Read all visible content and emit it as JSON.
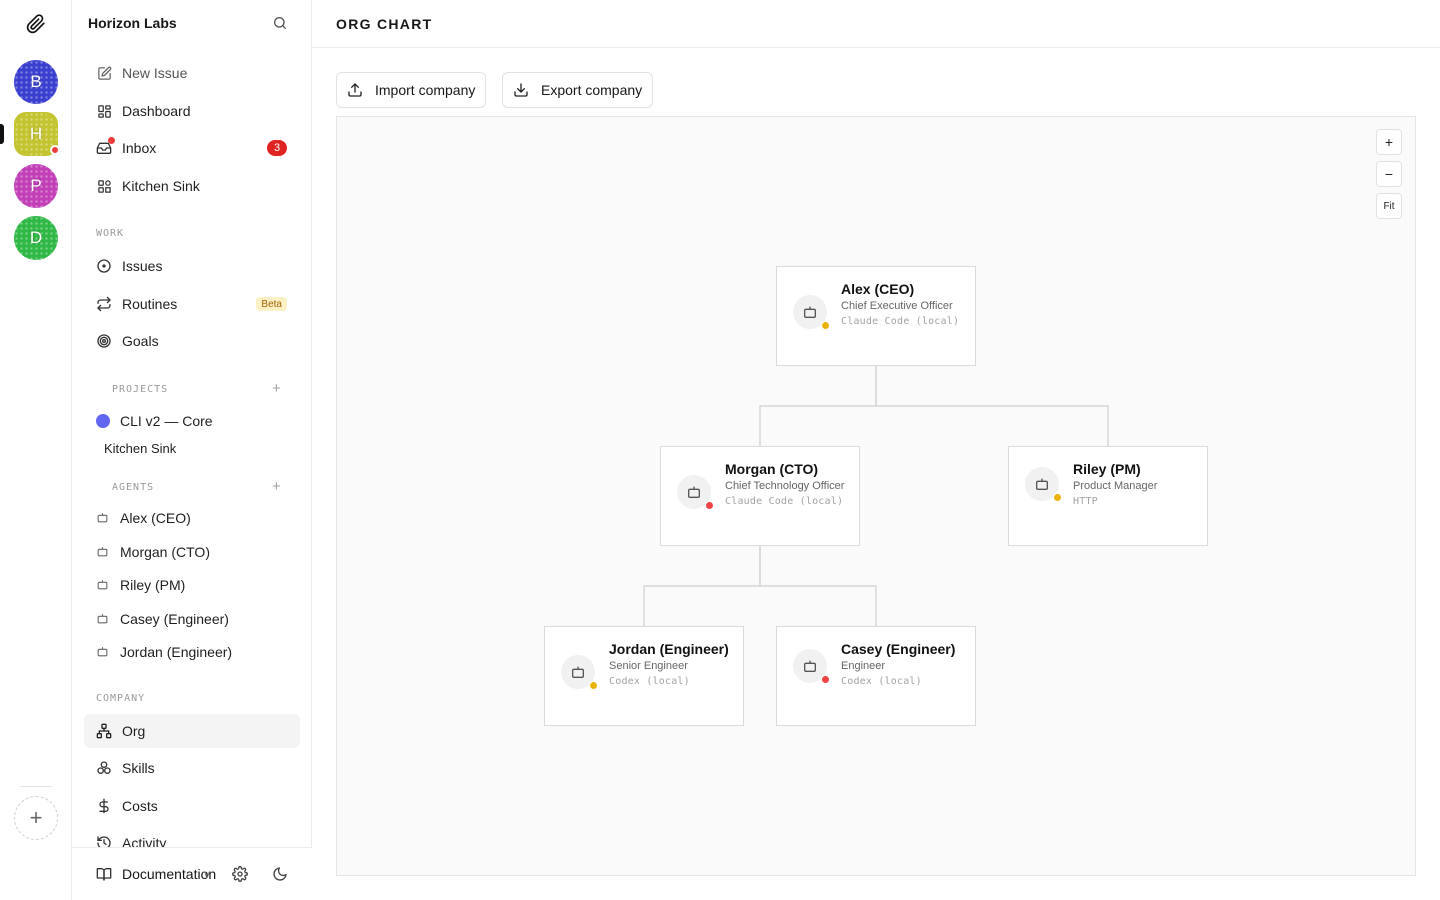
{
  "rail": {
    "companies": [
      {
        "initial": "B",
        "color": "#3b3fcf"
      },
      {
        "initial": "H",
        "color": "#c4c431",
        "active": true,
        "notification": true
      },
      {
        "initial": "P",
        "color": "#c23fb7"
      },
      {
        "initial": "D",
        "color": "#2fb845"
      }
    ],
    "add_label": "+"
  },
  "sidebar": {
    "company_name": "Horizon Labs",
    "top_items": [
      {
        "label": "New Issue",
        "icon": "edit-icon"
      },
      {
        "label": "Dashboard",
        "icon": "dashboard-icon"
      },
      {
        "label": "Inbox",
        "icon": "inbox-icon",
        "badge": "3"
      },
      {
        "label": "Kitchen Sink",
        "icon": "shapes-icon"
      }
    ],
    "work_label": "WORK",
    "work_items": [
      {
        "label": "Issues",
        "icon": "circle-dot-icon"
      },
      {
        "label": "Routines",
        "icon": "repeat-icon",
        "badge": "Beta"
      },
      {
        "label": "Goals",
        "icon": "target-icon"
      }
    ],
    "projects_label": "PROJECTS",
    "projects_add": "+",
    "projects": [
      {
        "label": "CLI v2 — Core",
        "color": "#6366f1",
        "children": [
          "Kitchen Sink"
        ]
      }
    ],
    "agents_label": "AGENTS",
    "agents_add": "+",
    "agents": [
      "Alex (CEO)",
      "Morgan (CTO)",
      "Riley (PM)",
      "Casey (Engineer)",
      "Jordan (Engineer)"
    ],
    "company_label": "COMPANY",
    "company_items": [
      {
        "label": "Org",
        "icon": "org-icon",
        "active": true
      },
      {
        "label": "Skills",
        "icon": "boxes-icon"
      },
      {
        "label": "Costs",
        "icon": "dollar-icon"
      },
      {
        "label": "Activity",
        "icon": "history-icon"
      }
    ],
    "footer": {
      "docs_label": "Documentation",
      "version": "v"
    }
  },
  "main": {
    "title": "ORG CHART",
    "import_label": "Import company",
    "export_label": "Export company",
    "zoom_in": "+",
    "zoom_out": "−",
    "fit": "Fit"
  },
  "org": {
    "nodes": [
      {
        "id": "alex",
        "name": "Alex (CEO)",
        "role": "Chief Executive Officer",
        "adapter": "Claude Code (local)",
        "status_color": "#eab308"
      },
      {
        "id": "morgan",
        "name": "Morgan (CTO)",
        "role": "Chief Technology Officer",
        "adapter": "Claude Code (local)",
        "status_color": "#ef4444"
      },
      {
        "id": "riley",
        "name": "Riley (PM)",
        "role": "Product Manager",
        "adapter": "HTTP",
        "status_color": "#eab308"
      },
      {
        "id": "jordan",
        "name": "Jordan (Engineer)",
        "role": "Senior Engineer",
        "adapter": "Codex (local)",
        "status_color": "#eab308"
      },
      {
        "id": "casey",
        "name": "Casey (Engineer)",
        "role": "Engineer",
        "adapter": "Codex (local)",
        "status_color": "#ef4444"
      }
    ],
    "reports_to": {
      "morgan": "alex",
      "riley": "alex",
      "jordan": "morgan",
      "casey": "morgan"
    }
  }
}
